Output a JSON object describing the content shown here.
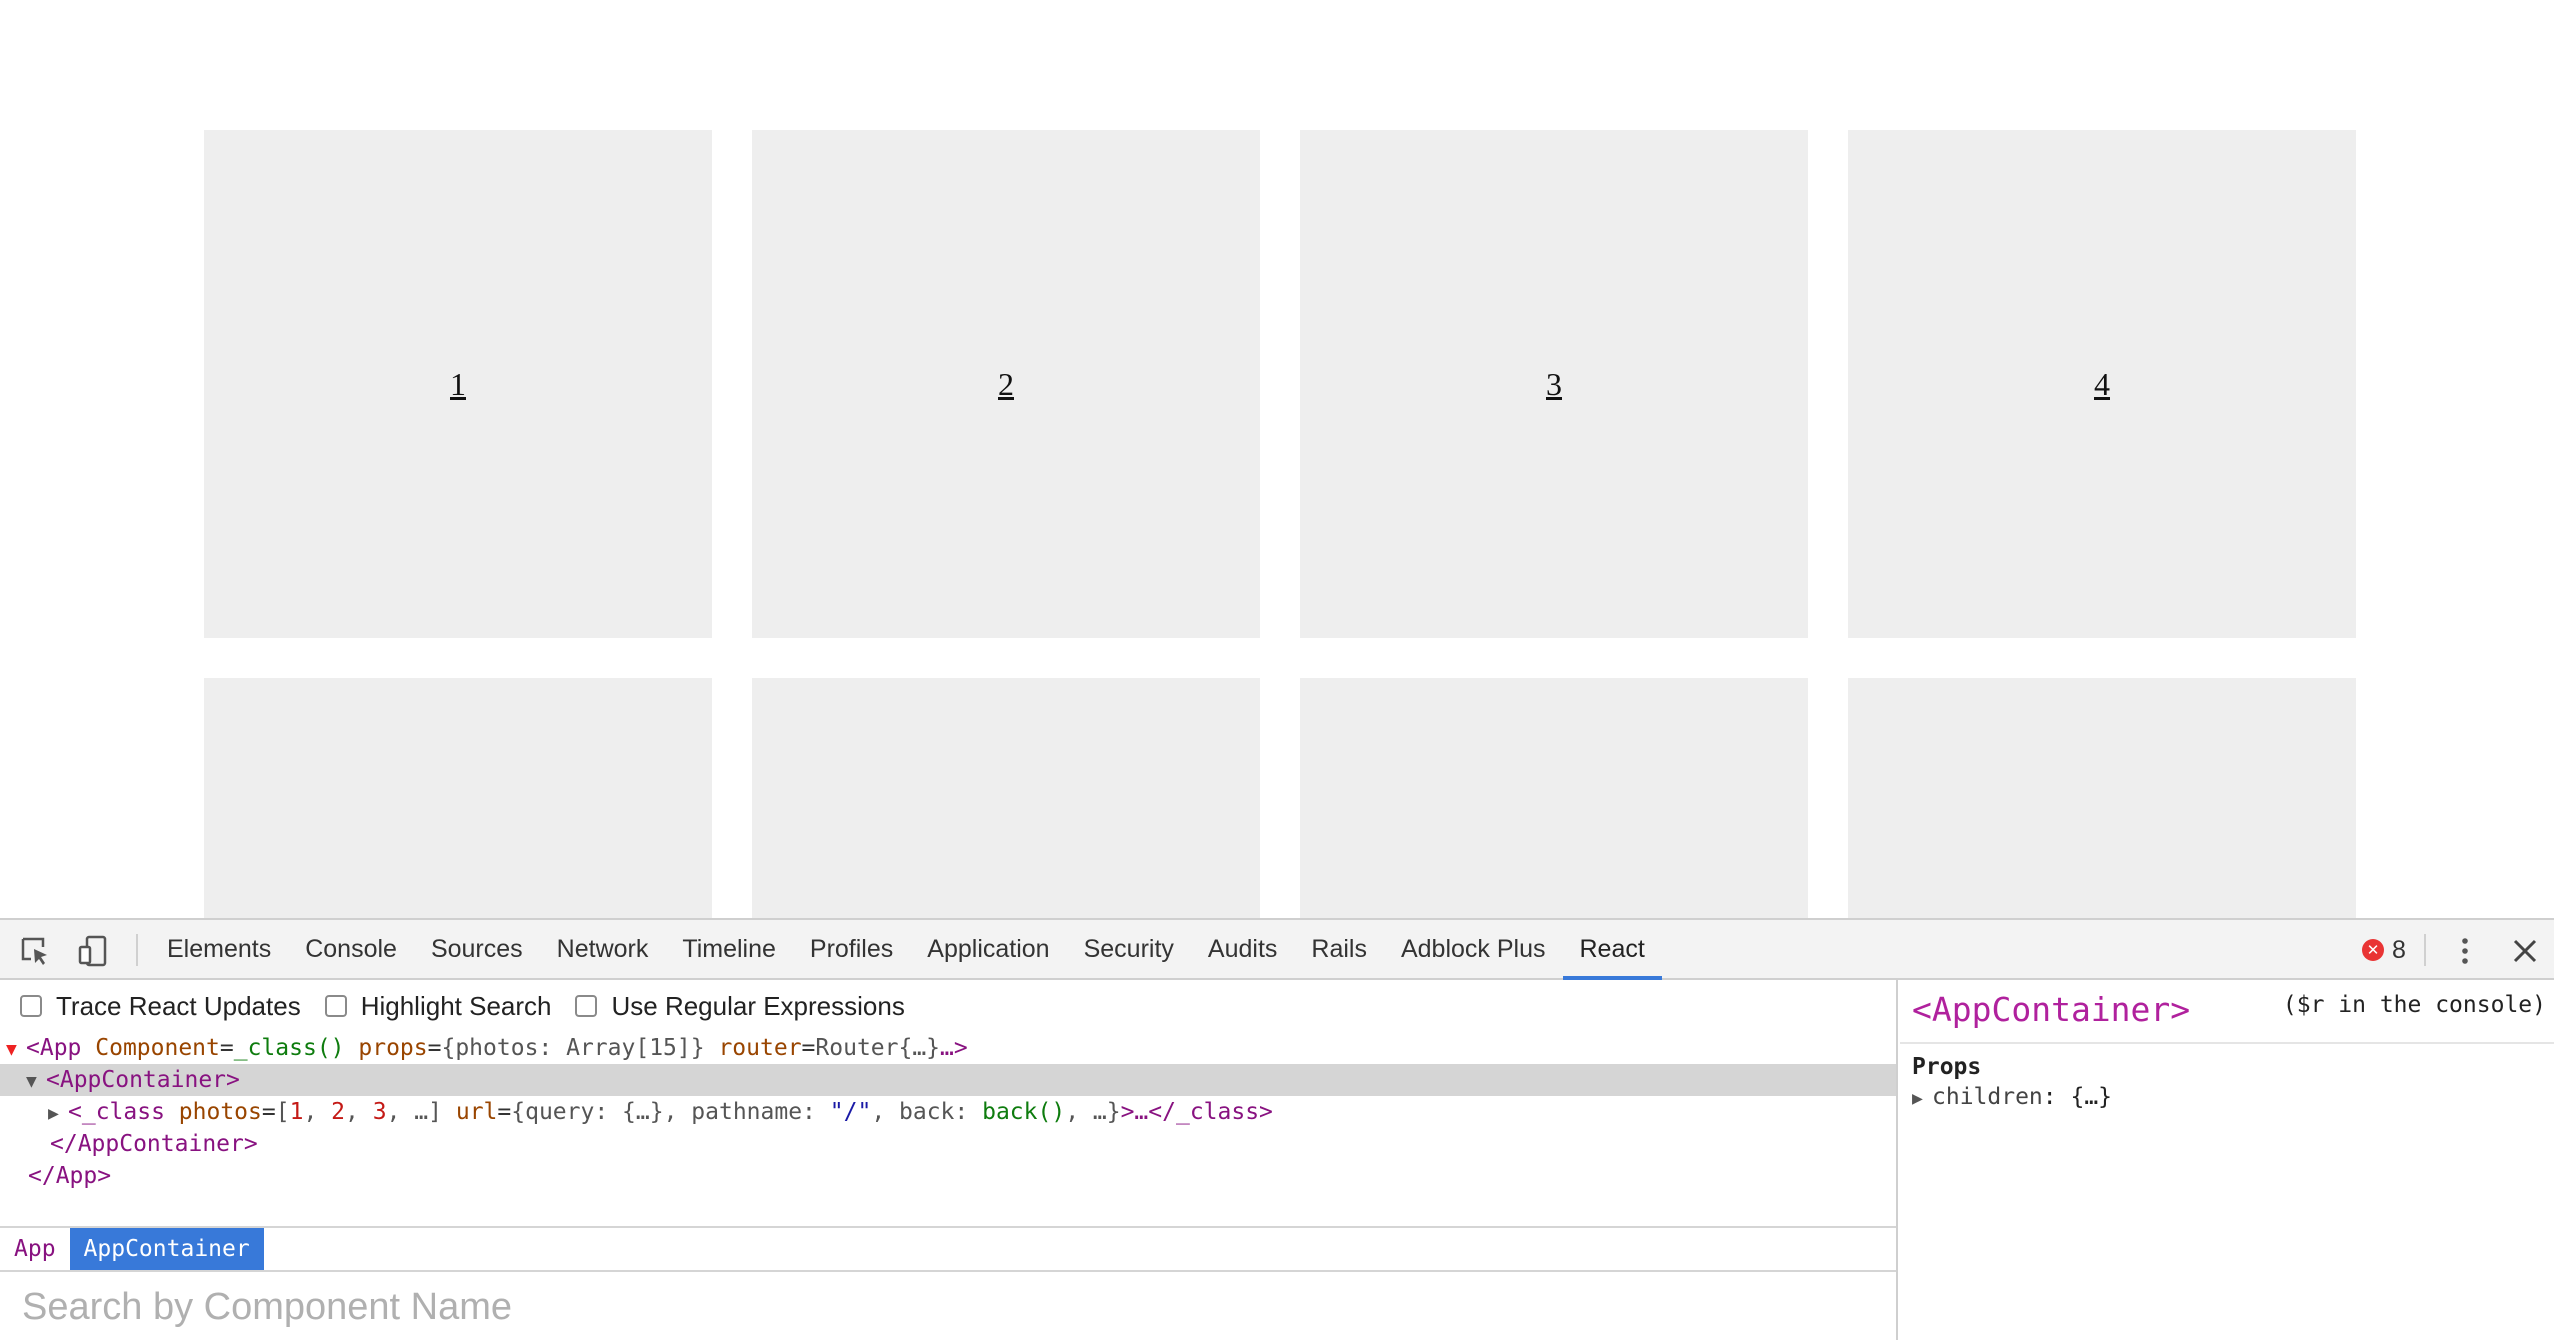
{
  "page": {
    "tiles": [
      {
        "label": "1"
      },
      {
        "label": "2"
      },
      {
        "label": "3"
      },
      {
        "label": "4"
      },
      {
        "label": ""
      },
      {
        "label": ""
      },
      {
        "label": ""
      },
      {
        "label": ""
      }
    ]
  },
  "devtools": {
    "tabs": [
      {
        "label": "Elements"
      },
      {
        "label": "Console"
      },
      {
        "label": "Sources"
      },
      {
        "label": "Network"
      },
      {
        "label": "Timeline"
      },
      {
        "label": "Profiles"
      },
      {
        "label": "Application"
      },
      {
        "label": "Security"
      },
      {
        "label": "Audits"
      },
      {
        "label": "Rails"
      },
      {
        "label": "Adblock Plus"
      },
      {
        "label": "React"
      }
    ],
    "active_tab": "React",
    "error_count": "8",
    "error_icon": "✕",
    "icons": {
      "inspect": "inspect-icon",
      "device": "device-toolbar-icon",
      "more": "more-vertical-icon",
      "close": "close-icon"
    },
    "options": {
      "trace": "Trace React Updates",
      "highlight": "Highlight Search",
      "regex": "Use Regular Expressions"
    },
    "tree": {
      "app_open": "<App",
      "app_attr1": "Component",
      "app_val1": "_class()",
      "app_attr2": "props",
      "app_val2": "{photos: Array[15]}",
      "app_attr3": "router",
      "app_val3": "Router{…}",
      "app_tail": "…>",
      "container_open": "<AppContainer>",
      "class_open": "<_class",
      "class_attr1": "photos",
      "class_bracket_open": "[",
      "class_n1": "1",
      "class_n2": "2",
      "class_n3": "3",
      "class_rest": "…]",
      "class_attr2": "url",
      "class_url_pre": "{query: {…}, pathname: ",
      "class_url_str": "\"/\"",
      "class_url_mid": ", back: ",
      "class_url_fn": "back()",
      "class_url_end": ", …}",
      "class_close": ">…</_class>",
      "container_close": "</AppContainer>",
      "app_close": "</App>"
    },
    "breadcrumbs": [
      {
        "label": "App"
      },
      {
        "label": "AppContainer"
      }
    ],
    "search": {
      "placeholder": "Search by Component Name",
      "value": ""
    },
    "sidebar": {
      "title": "<AppContainer>",
      "hint": "($r in the console)",
      "props_label": "Props",
      "prop_key": "children",
      "prop_value": "{…}"
    }
  }
}
